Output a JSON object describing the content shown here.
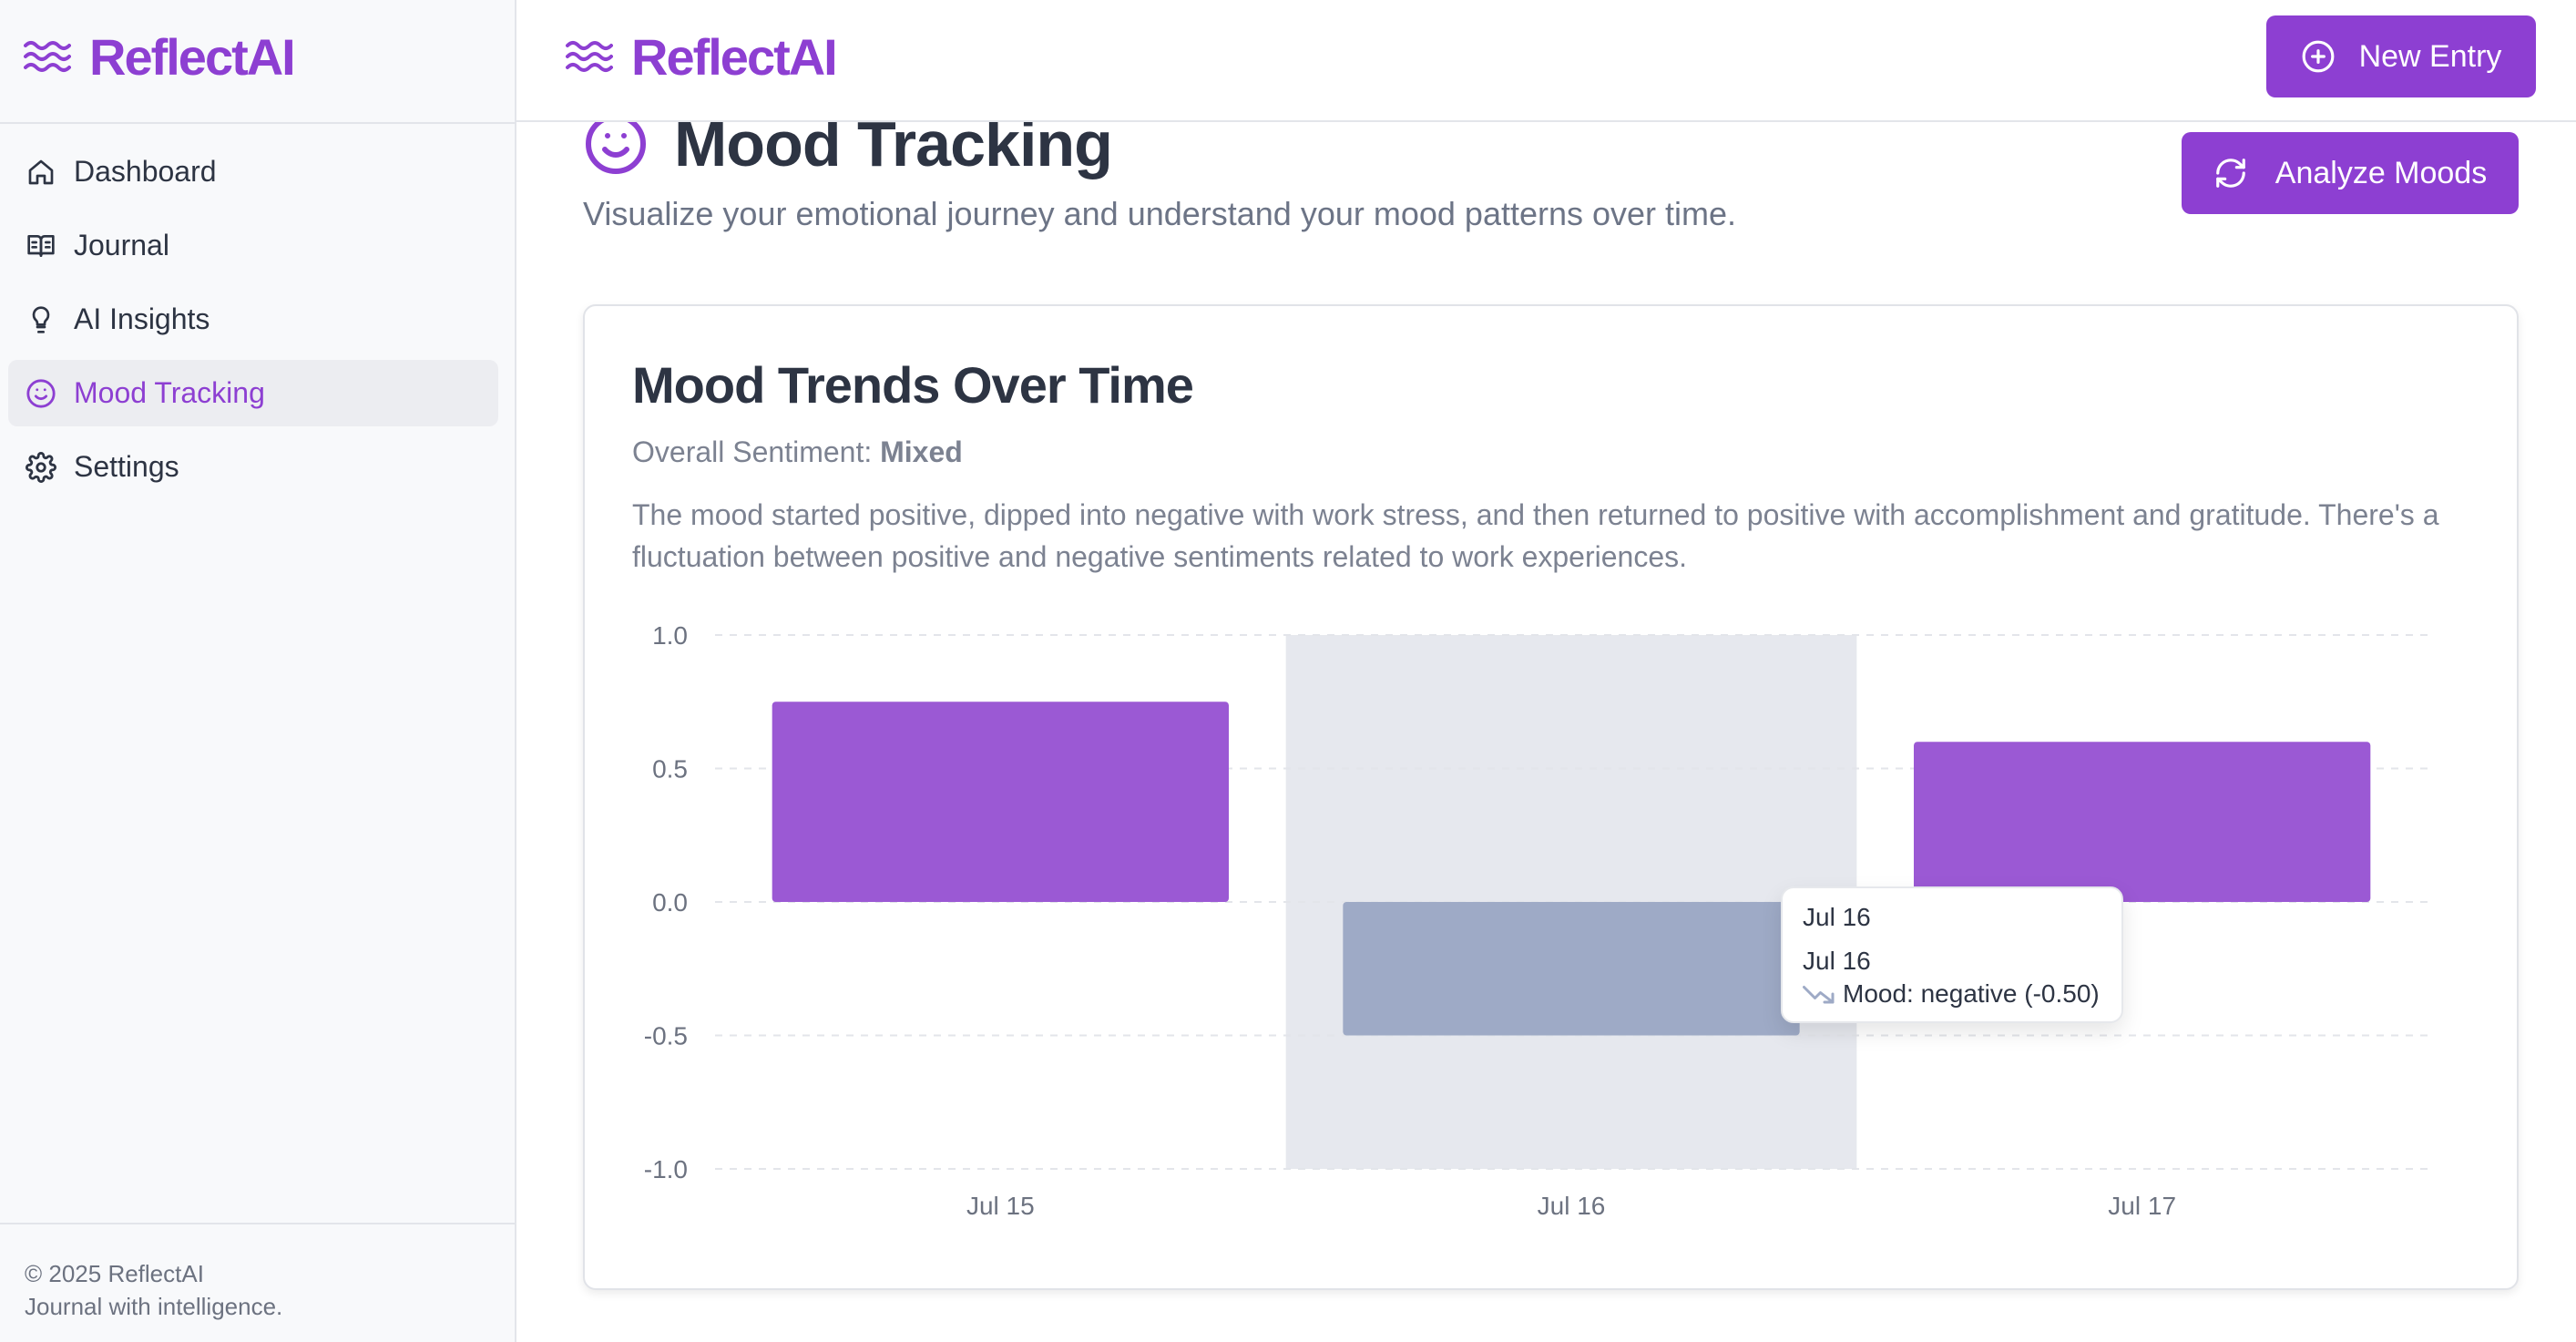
{
  "app": {
    "name": "ReflectAI"
  },
  "sidebar": {
    "items": [
      {
        "label": "Dashboard",
        "icon": "home-icon"
      },
      {
        "label": "Journal",
        "icon": "book-icon"
      },
      {
        "label": "AI Insights",
        "icon": "lightbulb-icon"
      },
      {
        "label": "Mood Tracking",
        "icon": "smile-icon",
        "active": true
      },
      {
        "label": "Settings",
        "icon": "gear-icon"
      }
    ],
    "footer": {
      "copyright": "© 2025 ReflectAI",
      "tagline": "Journal with intelligence."
    }
  },
  "header": {
    "new_entry_label": "New Entry"
  },
  "page": {
    "title": "Mood Tracking",
    "subtitle": "Visualize your emotional journey and understand your mood patterns over time.",
    "analyze_label": "Analyze Moods"
  },
  "card": {
    "title": "Mood Trends Over Time",
    "sentiment_label": "Overall Sentiment:",
    "sentiment_value": "Mixed",
    "summary": "The mood started positive, dipped into negative with work stress, and then returned to positive with accomplishment and gratitude. There's a fluctuation between positive and negative sentiments related to work experiences."
  },
  "tooltip": {
    "title": "Jul 16",
    "date": "Jul 16",
    "mood_text": "Mood: negative (-0.50)"
  },
  "colors": {
    "accent": "#8d3fd2",
    "bar_positive": "#9b59d4",
    "bar_negative": "#9eaac6",
    "hover_band": "#e6e8ee"
  },
  "chart_data": {
    "type": "bar",
    "categories": [
      "Jul 15",
      "Jul 16",
      "Jul 17"
    ],
    "values": [
      0.75,
      -0.5,
      0.6
    ],
    "ylim": [
      -1.0,
      1.0
    ],
    "yticks": [
      "1.0",
      "0.5",
      "0.0",
      "-0.5",
      "-1.0"
    ],
    "grid": true,
    "highlighted_category": "Jul 16"
  }
}
